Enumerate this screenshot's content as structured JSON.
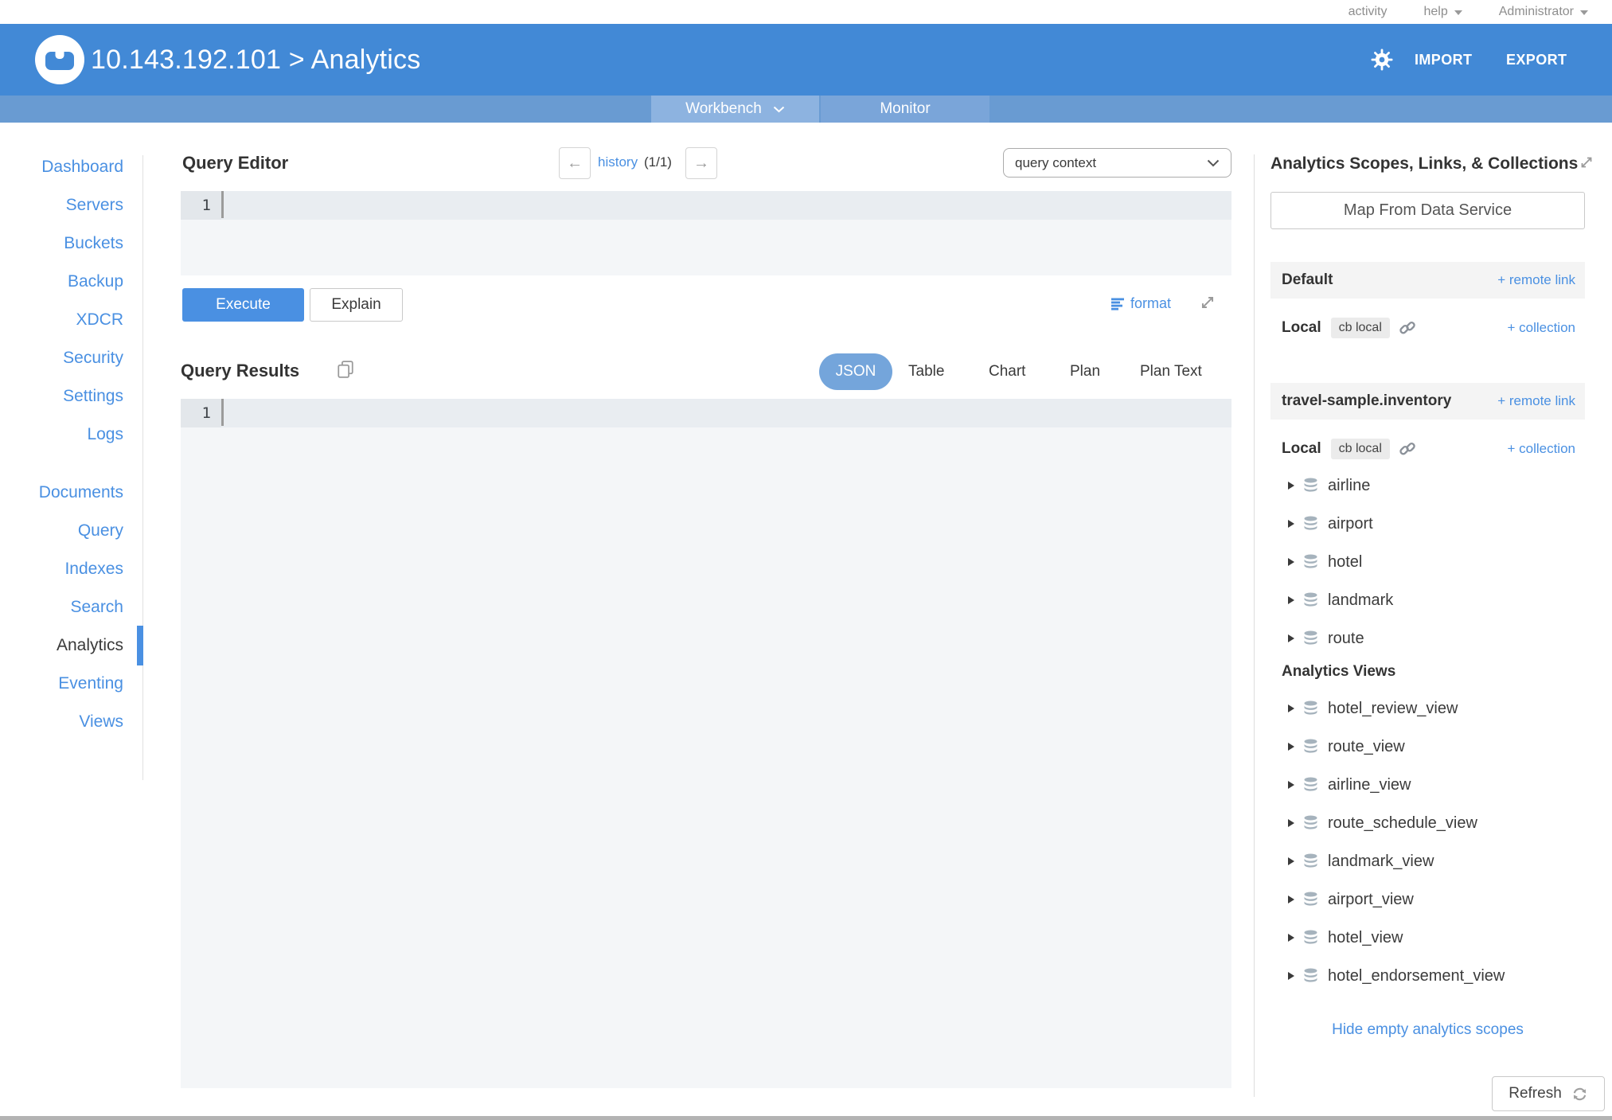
{
  "topbar": {
    "activity": "activity",
    "help": "help",
    "administrator": "Administrator"
  },
  "header": {
    "title": "10.143.192.101 > Analytics",
    "import_label": "IMPORT",
    "export_label": "EXPORT"
  },
  "subnav": {
    "workbench": "Workbench",
    "monitor": "Monitor"
  },
  "sidebar": {
    "items": [
      "Dashboard",
      "Servers",
      "Buckets",
      "Backup",
      "XDCR",
      "Security",
      "Settings",
      "Logs",
      "Documents",
      "Query",
      "Indexes",
      "Search",
      "Analytics",
      "Eventing",
      "Views"
    ]
  },
  "query_editor": {
    "title": "Query Editor",
    "history_prev": "←",
    "history_label": "history",
    "history_counter": "(1/1)",
    "history_next": "→",
    "context_value": "query context",
    "line_number": "1",
    "execute_label": "Execute",
    "explain_label": "Explain",
    "format_label": "format"
  },
  "query_results": {
    "title": "Query Results",
    "line_number": "1",
    "tabs": [
      "JSON",
      "Table",
      "Chart",
      "Plan",
      "Plan Text"
    ],
    "active_tab": "JSON"
  },
  "right_panel": {
    "title": "Analytics Scopes, Links, & Collections",
    "map_button_label": "Map From Data Service",
    "default_scope": {
      "name": "Default",
      "remote_link_label": "+ remote link",
      "local_label": "Local",
      "link_chip": "cb local",
      "collection_link_label": "+ collection"
    },
    "inventory_scope": {
      "name": "travel-sample.inventory",
      "remote_link_label": "+ remote link",
      "local_label": "Local",
      "link_chip": "cb local",
      "collection_link_label": "+ collection",
      "collections": [
        "airline",
        "airport",
        "hotel",
        "landmark",
        "route"
      ],
      "views_header": "Analytics Views",
      "views": [
        "hotel_review_view",
        "route_view",
        "airline_view",
        "route_schedule_view",
        "landmark_view",
        "airport_view",
        "hotel_view",
        "hotel_endorsement_view"
      ]
    },
    "hide_link_label": "Hide empty analytics scopes",
    "refresh_label": "Refresh"
  },
  "colors": {
    "header_blue": "#4289d6",
    "subnav_blue": "#699bd2",
    "link_blue": "#4a90e2",
    "active_pill_blue": "#74a5db",
    "editor_bg": "#f4f6f8",
    "editor_line1_bg": "#e9edf1"
  }
}
